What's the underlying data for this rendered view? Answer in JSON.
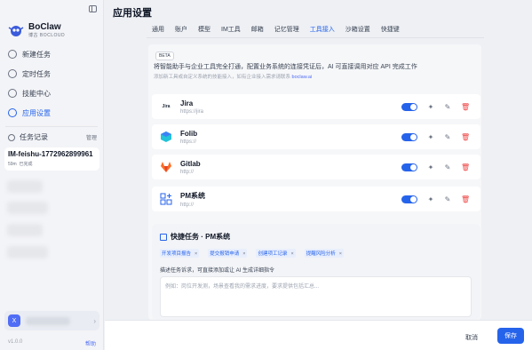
{
  "app": {
    "name": "BoClaw",
    "subtitle": "博古 BOCLOUD"
  },
  "sidebar": {
    "items": [
      {
        "label": "新建任务",
        "icon": "plus-circle-icon"
      },
      {
        "label": "定时任务",
        "icon": "clock-icon"
      },
      {
        "label": "技能中心",
        "icon": "sparkle-icon"
      },
      {
        "label": "应用设置",
        "icon": "gear-icon",
        "active": true
      }
    ],
    "tasks_label": "任务记录",
    "manage_label": "管理",
    "task": {
      "name": "IM-feishu-1772962899961",
      "time": "59m",
      "status": "已完成"
    },
    "user_initial": "X",
    "version": "v1.0.0",
    "help": "帮助"
  },
  "page": {
    "title": "应用设置",
    "tabs": [
      "通用",
      "账户",
      "模型",
      "IM工具",
      "邮箱",
      "记忆管理",
      "工具接入",
      "沙箱设置",
      "快捷键"
    ],
    "active_tab": "工具接入"
  },
  "integration": {
    "badge": "BETA",
    "headline": "将智能助手与企业工具完全打通，配置业务系统的连接凭证后，AI 可直接调用对应 API 完成工作",
    "subline_prefix": "添加新工具或自定义系统的技能接入，如有企业接入需求请联系",
    "subline_link": "boclaw.ai",
    "tools": [
      {
        "name": "Jira",
        "url": "https://jira",
        "logo": "jira-logo",
        "enabled": true
      },
      {
        "name": "Folib",
        "url": "https://",
        "logo": "folib-logo",
        "enabled": true
      },
      {
        "name": "Gitlab",
        "url": "http://",
        "logo": "gitlab-logo",
        "enabled": true
      },
      {
        "name": "PM系统",
        "url": "http://",
        "logo": "grid-plus-icon",
        "enabled": true
      }
    ]
  },
  "quick": {
    "title": "快捷任务 · PM系统",
    "chips": [
      "开发项目报告",
      "提交报销申请",
      "创建项工记录",
      "提醒风险分析"
    ],
    "hint": "描述任务诉求，可直接添加或让 AI 生成详细指令",
    "placeholder": "例如：岗位开发测，场景查看我的需求进度，要求提供包括汇总..."
  },
  "footer": {
    "cancel": "取消",
    "save": "保存"
  },
  "colors": {
    "accent": "#2563eb",
    "danger": "#ef4444"
  }
}
